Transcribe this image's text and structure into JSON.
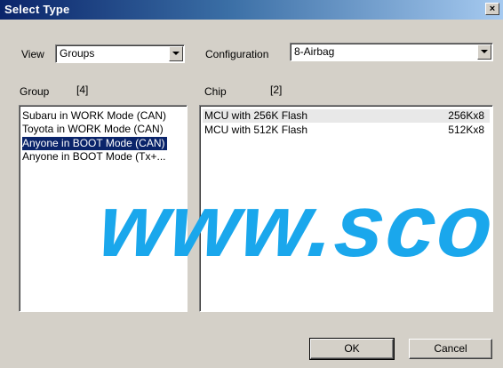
{
  "window": {
    "title": "Select Type",
    "close_symbol": "×"
  },
  "view": {
    "label": "View",
    "value": "Groups"
  },
  "configuration": {
    "label": "Configuration",
    "value": "8-Airbag"
  },
  "group": {
    "label": "Group",
    "count": "[4]",
    "items": [
      "Subaru in WORK Mode (CAN)",
      "Toyota in WORK Mode (CAN)",
      "Anyone in BOOT Mode (CAN)",
      "Anyone in BOOT Mode (Tx+..."
    ],
    "selected_index": 2
  },
  "chip": {
    "label": "Chip",
    "count": "[2]",
    "items": [
      {
        "name": "MCU with 256K Flash",
        "size": "256Kx8"
      },
      {
        "name": "MCU with 512K Flash",
        "size": "512Kx8"
      }
    ]
  },
  "buttons": {
    "ok": "OK",
    "cancel": "Cancel"
  },
  "watermark": "www.sco",
  "colors": {
    "title_bar": "#0a246a",
    "selection": "#0a246a",
    "watermark": "#1aa7ec",
    "face": "#d4d0c8"
  },
  "icons": {
    "close": "close-icon",
    "dropdown": "chevron-down-icon"
  }
}
